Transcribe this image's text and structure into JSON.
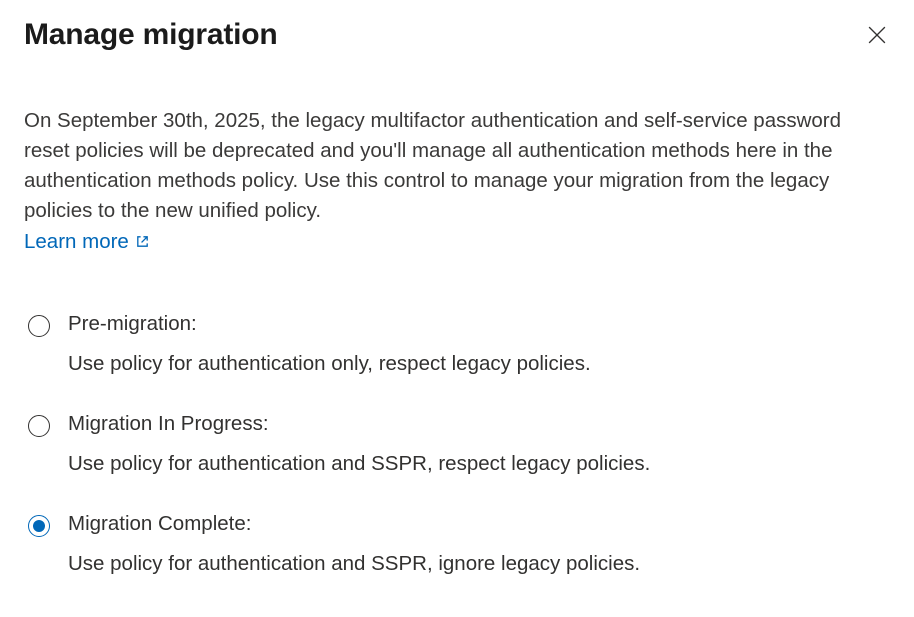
{
  "header": {
    "title": "Manage migration"
  },
  "description": "On September 30th, 2025, the legacy multifactor authentication and self-service password reset policies will be deprecated and you'll manage all authentication methods here in the authentication methods policy. Use this control to manage your migration from the legacy policies to the new unified policy.",
  "learn_more_label": "Learn more",
  "options": [
    {
      "label": "Pre-migration:",
      "description": "Use policy for authentication only, respect legacy policies.",
      "selected": false
    },
    {
      "label": "Migration In Progress:",
      "description": "Use policy for authentication and SSPR, respect legacy policies.",
      "selected": false
    },
    {
      "label": "Migration Complete:",
      "description": "Use policy for authentication and SSPR, ignore legacy policies.",
      "selected": true
    }
  ]
}
